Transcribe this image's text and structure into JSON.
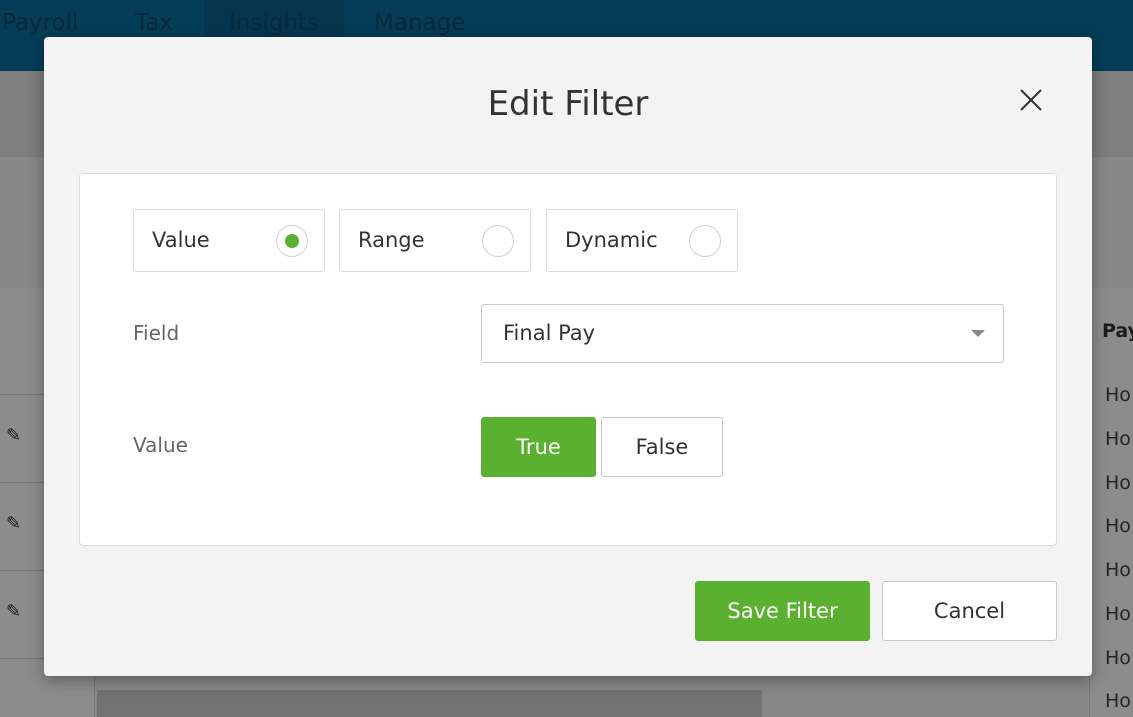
{
  "nav": {
    "tabs": [
      {
        "label": "Payroll"
      },
      {
        "label": "Tax"
      },
      {
        "label": "Insights"
      },
      {
        "label": "Manage"
      }
    ]
  },
  "background_table": {
    "header": "Pay",
    "cells": [
      "Ho",
      "Ho",
      "Ho",
      "Ho",
      "Ho",
      "Ho",
      "Ho",
      "Ho"
    ]
  },
  "modal": {
    "title": "Edit Filter",
    "filter_types": [
      {
        "label": "Value",
        "selected": true
      },
      {
        "label": "Range",
        "selected": false
      },
      {
        "label": "Dynamic",
        "selected": false
      }
    ],
    "field_label": "Field",
    "field_value": "Final Pay",
    "value_label": "Value",
    "value_options": [
      {
        "label": "True",
        "selected": true
      },
      {
        "label": "False",
        "selected": false
      }
    ],
    "save_label": "Save Filter",
    "cancel_label": "Cancel"
  },
  "colors": {
    "accent": "#5ab130",
    "nav": "#0a6fa0"
  }
}
